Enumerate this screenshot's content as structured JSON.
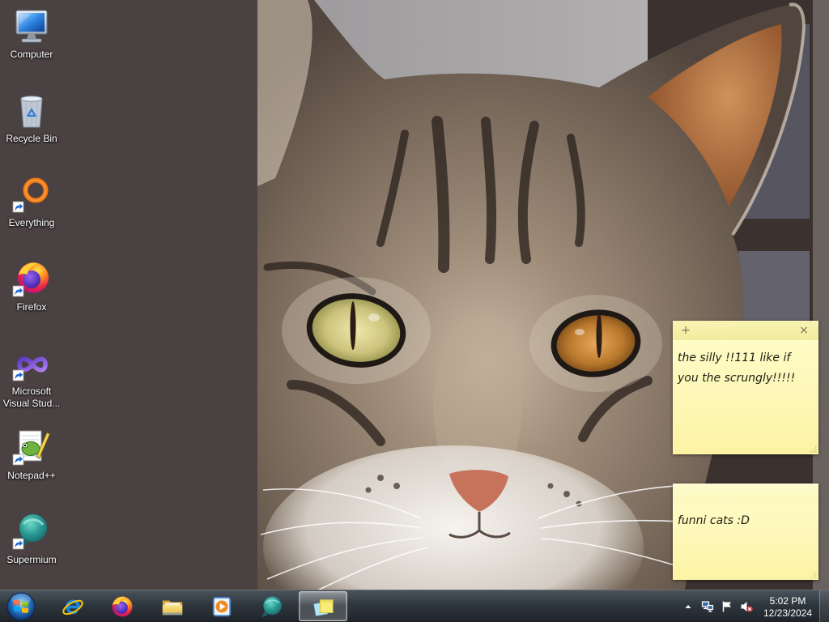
{
  "desktop": {
    "icons": [
      {
        "label": "Computer",
        "icon": "computer-icon",
        "shortcut": false
      },
      {
        "label": "Recycle Bin",
        "icon": "recycle-bin-icon",
        "shortcut": false
      },
      {
        "label": "Everything",
        "icon": "everything-icon",
        "shortcut": true
      },
      {
        "label": "Firefox",
        "icon": "firefox-icon",
        "shortcut": true
      },
      {
        "label": "Microsoft Visual Stud...",
        "icon": "visual-studio-icon",
        "shortcut": true
      },
      {
        "label": "Notepad++",
        "icon": "notepad-plus-plus-icon",
        "shortcut": true
      },
      {
        "label": "Supermium",
        "icon": "supermium-icon",
        "shortcut": true
      }
    ],
    "wallpaper": "cat-photo"
  },
  "sticky_notes": [
    {
      "text": "the silly !!111 like if you the scrungly!!!!!",
      "add_label": "+",
      "close_label": "×",
      "focused": true
    },
    {
      "text": "funni cats :D",
      "focused": false
    }
  ],
  "taskbar": {
    "start_button": "windows-start-orb",
    "buttons": [
      {
        "icon": "internet-explorer-icon",
        "active": false
      },
      {
        "icon": "firefox-icon",
        "active": false
      },
      {
        "icon": "file-explorer-icon",
        "active": false
      },
      {
        "icon": "media-player-icon",
        "active": false
      },
      {
        "icon": "supermium-icon",
        "active": false
      },
      {
        "icon": "sticky-notes-icon",
        "active": true
      }
    ],
    "tray_icons": [
      "show-hidden-icons-arrow",
      "network-icon",
      "action-center-flag-icon",
      "volume-muted-icon"
    ]
  },
  "clock": {
    "time": "5:02 PM",
    "date": "12/23/2024"
  },
  "colors": {
    "desktop_panel": "#4a4142",
    "sticky_note": "#fdf8b8",
    "taskbar": "#2f373e",
    "active_taskbar_button": "#8a949c"
  }
}
